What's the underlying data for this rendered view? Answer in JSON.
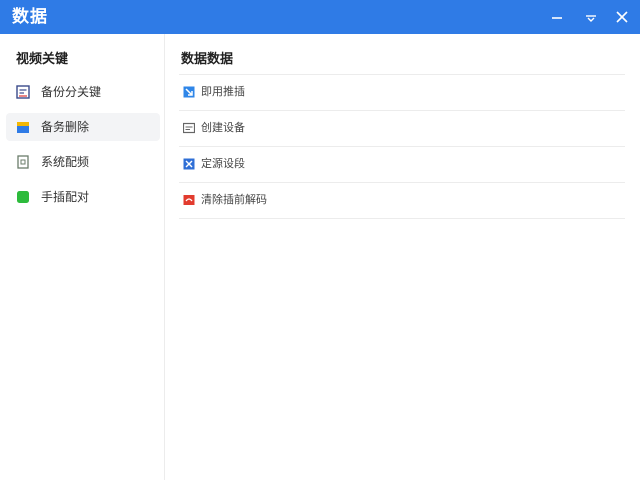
{
  "window": {
    "title": "数据"
  },
  "colors": {
    "titlebar": "#2f7be6",
    "active_item_bg": "#f3f4f6"
  },
  "sidebar": {
    "heading": "视频关键",
    "items": [
      {
        "label": "备份分关键",
        "icon": "document-chart-icon",
        "active": false
      },
      {
        "label": "备务删除",
        "icon": "folder-icon",
        "active": true
      },
      {
        "label": "系统配频",
        "icon": "file-icon",
        "active": false
      },
      {
        "label": "手插配对",
        "icon": "green-square-icon",
        "active": false
      }
    ]
  },
  "main": {
    "heading": "数据数据",
    "rows": [
      {
        "label": "即用推插",
        "icon": "arrow-box-icon"
      },
      {
        "label": "创建设备",
        "icon": "device-icon"
      },
      {
        "label": "定源设段",
        "icon": "shrink-arrows-icon"
      },
      {
        "label": "清除插前解码",
        "icon": "red-card-icon"
      }
    ]
  }
}
